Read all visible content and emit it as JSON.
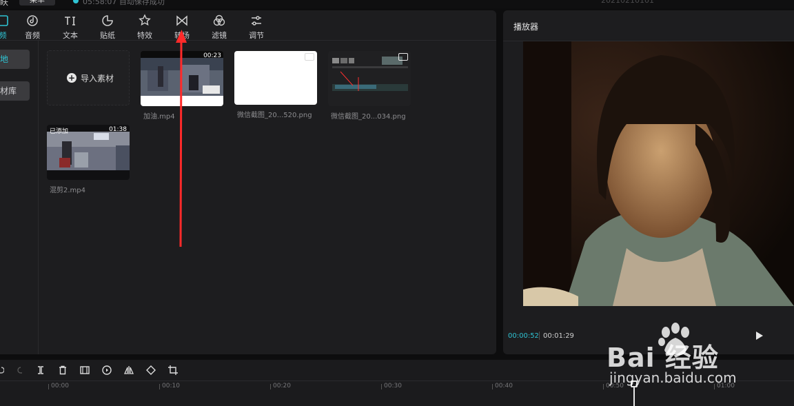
{
  "app": {
    "menu_partial": "眹",
    "menu_button": "菜单",
    "save_status": "05:58:07 自动保存成功",
    "project_title": "20210210101"
  },
  "toolbar": {
    "items": [
      {
        "label": "频",
        "icon": "media-icon"
      },
      {
        "label": "音频",
        "icon": "audio-icon"
      },
      {
        "label": "文本",
        "icon": "text-icon"
      },
      {
        "label": "贴纸",
        "icon": "sticker-icon"
      },
      {
        "label": "特效",
        "icon": "effects-icon"
      },
      {
        "label": "转场",
        "icon": "transition-icon"
      },
      {
        "label": "滤镜",
        "icon": "filter-icon"
      },
      {
        "label": "调节",
        "icon": "adjust-icon"
      }
    ]
  },
  "sidebar": {
    "items": [
      {
        "label": "地"
      },
      {
        "label": "材库"
      }
    ]
  },
  "media": {
    "import_label": "导入素材",
    "items": [
      {
        "name": "加油.mp4",
        "duration": "00:23"
      },
      {
        "name": "微信截图_20...520.png"
      },
      {
        "name": "微信截图_20...034.png"
      },
      {
        "name": "混剪2.mp4",
        "duration": "01:38",
        "status": "已添加"
      }
    ]
  },
  "player": {
    "title": "播放器",
    "current_time": "00:00:52",
    "total_time": "00:01:29"
  },
  "timeline": {
    "ticks": [
      "00:00",
      "00:10",
      "00:20",
      "00:30",
      "00:40",
      "00:50",
      "01:00"
    ]
  },
  "watermark": {
    "main": "Bai 经验",
    "sub": "jingyan.baidu.com"
  },
  "colors": {
    "accent": "#2fc4d4",
    "arrow": "#ff2a2a",
    "panel": "#1d1d1f"
  }
}
